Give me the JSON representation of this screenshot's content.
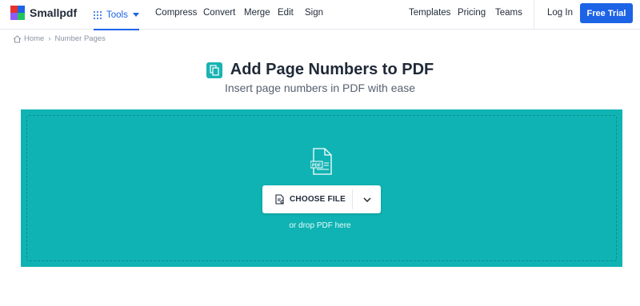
{
  "brand": {
    "name": "Smallpdf",
    "logo_colors": [
      "#e5322d",
      "#1d63e6",
      "#22c55e",
      "#8b5cf6"
    ]
  },
  "nav": {
    "tools_label": "Tools",
    "links": [
      "Compress",
      "Convert",
      "Merge",
      "Edit",
      "Sign"
    ],
    "right_links": [
      "Templates",
      "Pricing",
      "Teams"
    ],
    "login_label": "Log In",
    "trial_label": "Free Trial"
  },
  "breadcrumb": {
    "home_label": "Home",
    "current_label": "Number Pages",
    "separator": "›"
  },
  "hero": {
    "title": "Add Page Numbers to PDF",
    "subtitle": "Insert page numbers in PDF with ease"
  },
  "upload": {
    "file_badge": "PDF",
    "choose_label": "CHOOSE FILE",
    "drop_hint": "or drop PDF here"
  },
  "colors": {
    "accent_blue": "#1d63e6",
    "teal": "#10b3b3"
  },
  "icons": {
    "home": "home-icon",
    "grid": "grid-icon",
    "file": "pdf-file-icon",
    "chevron": "chevron-down-icon"
  }
}
